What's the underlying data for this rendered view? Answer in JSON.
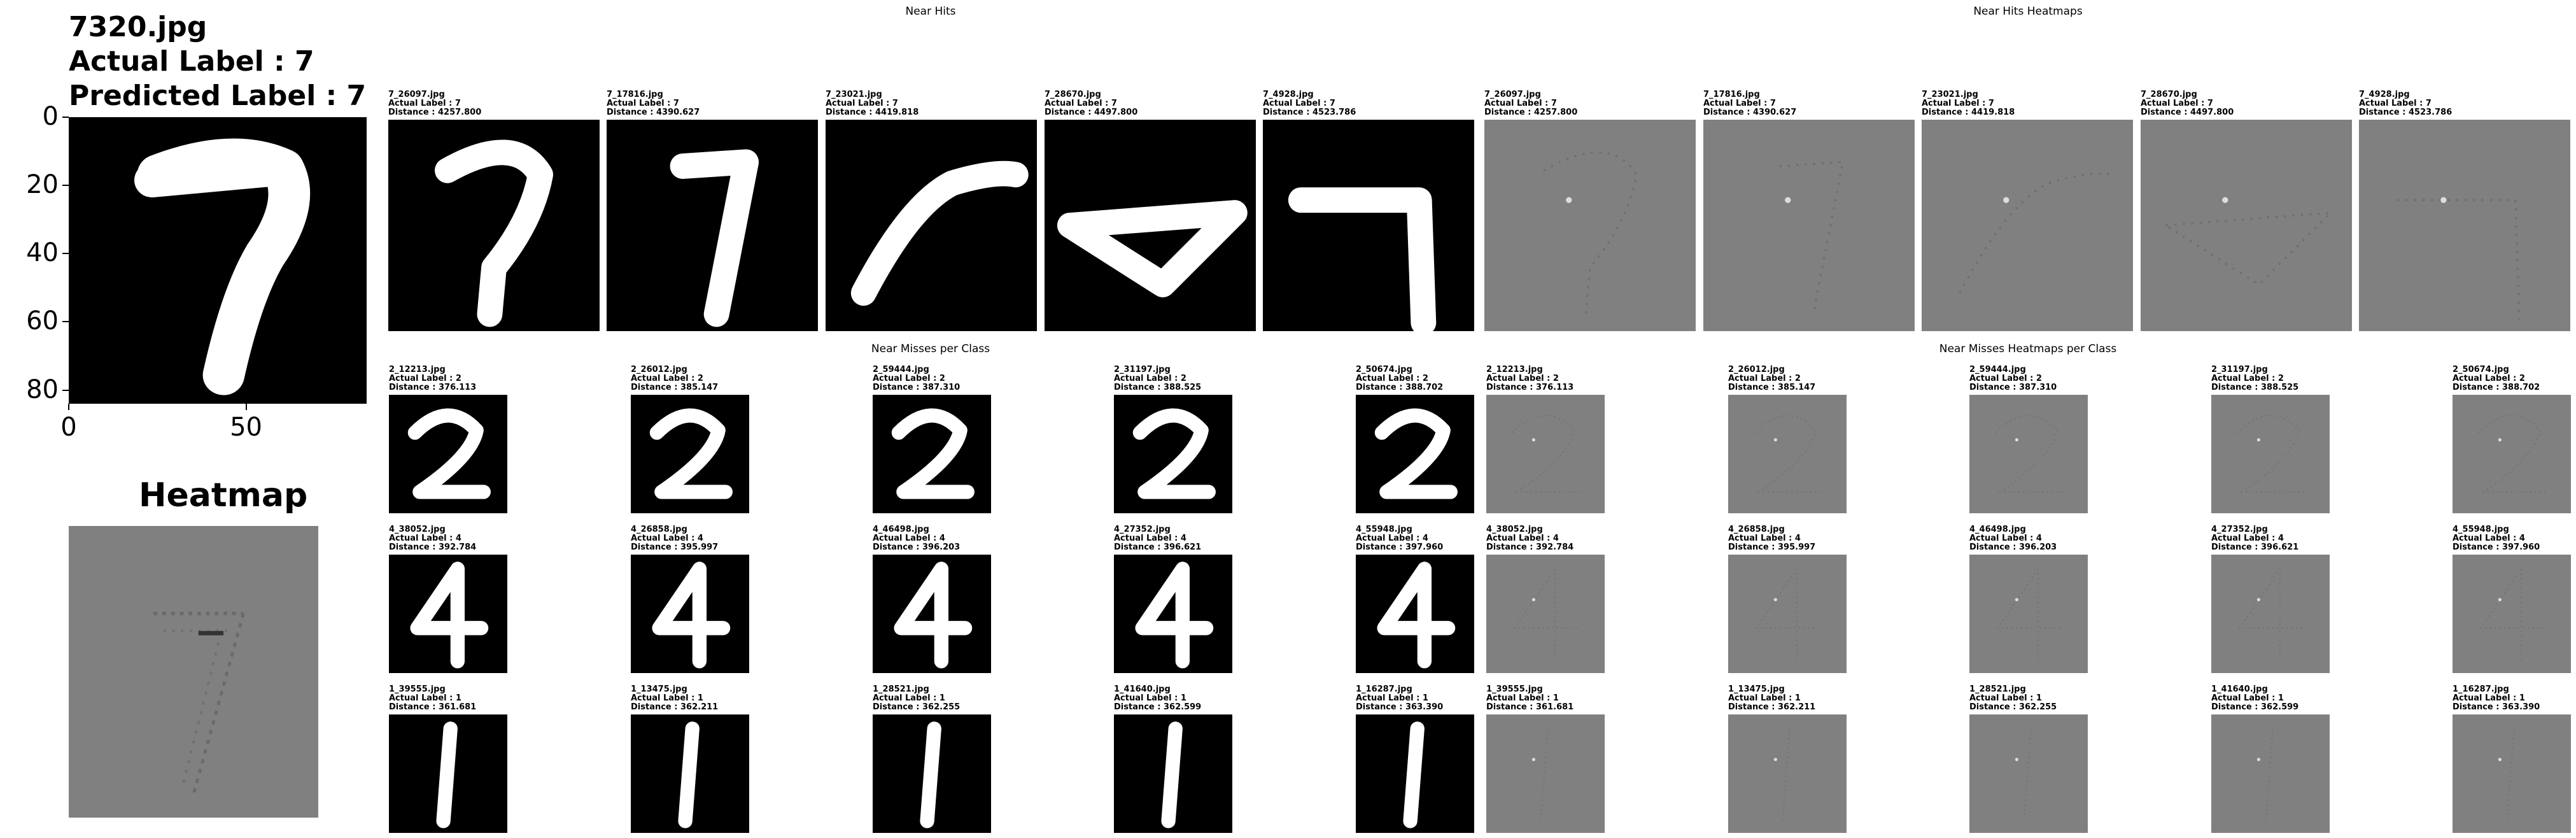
{
  "main": {
    "filename": "7320.jpg",
    "actual": "Actual Label : 7",
    "predicted": "Predicted Label : 7",
    "heatmap_title": "Heatmap",
    "yticks": [
      "0",
      "20",
      "40",
      "60",
      "80"
    ],
    "xticks": [
      "0",
      "50"
    ]
  },
  "sections": {
    "near_hits": "Near Hits",
    "near_hits_heatmaps": "Near Hits Heatmaps",
    "near_misses": "Near Misses per Class",
    "near_misses_heatmaps": "Near Misses Heatmaps per Class"
  },
  "near_hits": [
    {
      "name": "7_26097.jpg",
      "actual": "Actual Label : 7",
      "distance": "Distance : 4257.800"
    },
    {
      "name": "7_17816.jpg",
      "actual": "Actual Label : 7",
      "distance": "Distance : 4390.627"
    },
    {
      "name": "7_23021.jpg",
      "actual": "Actual Label : 7",
      "distance": "Distance : 4419.818"
    },
    {
      "name": "7_28670.jpg",
      "actual": "Actual Label : 7",
      "distance": "Distance : 4497.800"
    },
    {
      "name": "7_4928.jpg",
      "actual": "Actual Label : 7",
      "distance": "Distance : 4523.786"
    }
  ],
  "near_misses": [
    [
      {
        "name": "2_12213.jpg",
        "actual": "Actual Label : 2",
        "distance": "Distance : 376.113"
      },
      {
        "name": "2_26012.jpg",
        "actual": "Actual Label : 2",
        "distance": "Distance : 385.147"
      },
      {
        "name": "2_59444.jpg",
        "actual": "Actual Label : 2",
        "distance": "Distance : 387.310"
      },
      {
        "name": "2_31197.jpg",
        "actual": "Actual Label : 2",
        "distance": "Distance : 388.525"
      },
      {
        "name": "2_50674.jpg",
        "actual": "Actual Label : 2",
        "distance": "Distance : 388.702"
      }
    ],
    [
      {
        "name": "4_38052.jpg",
        "actual": "Actual Label : 4",
        "distance": "Distance : 392.784"
      },
      {
        "name": "4_26858.jpg",
        "actual": "Actual Label : 4",
        "distance": "Distance : 395.997"
      },
      {
        "name": "4_46498.jpg",
        "actual": "Actual Label : 4",
        "distance": "Distance : 396.203"
      },
      {
        "name": "4_27352.jpg",
        "actual": "Actual Label : 4",
        "distance": "Distance : 396.621"
      },
      {
        "name": "4_55948.jpg",
        "actual": "Actual Label : 4",
        "distance": "Distance : 397.960"
      }
    ],
    [
      {
        "name": "1_39555.jpg",
        "actual": "Actual Label : 1",
        "distance": "Distance : 361.681"
      },
      {
        "name": "1_13475.jpg",
        "actual": "Actual Label : 1",
        "distance": "Distance : 362.211"
      },
      {
        "name": "1_28521.jpg",
        "actual": "Actual Label : 1",
        "distance": "Distance : 362.255"
      },
      {
        "name": "1_41640.jpg",
        "actual": "Actual Label : 1",
        "distance": "Distance : 362.599"
      },
      {
        "name": "1_16287.jpg",
        "actual": "Actual Label : 1",
        "distance": "Distance : 363.390"
      }
    ]
  ],
  "colors": {
    "digit_bg": "#000000",
    "digit_fg": "#ffffff",
    "heat_bg": "#808080"
  }
}
